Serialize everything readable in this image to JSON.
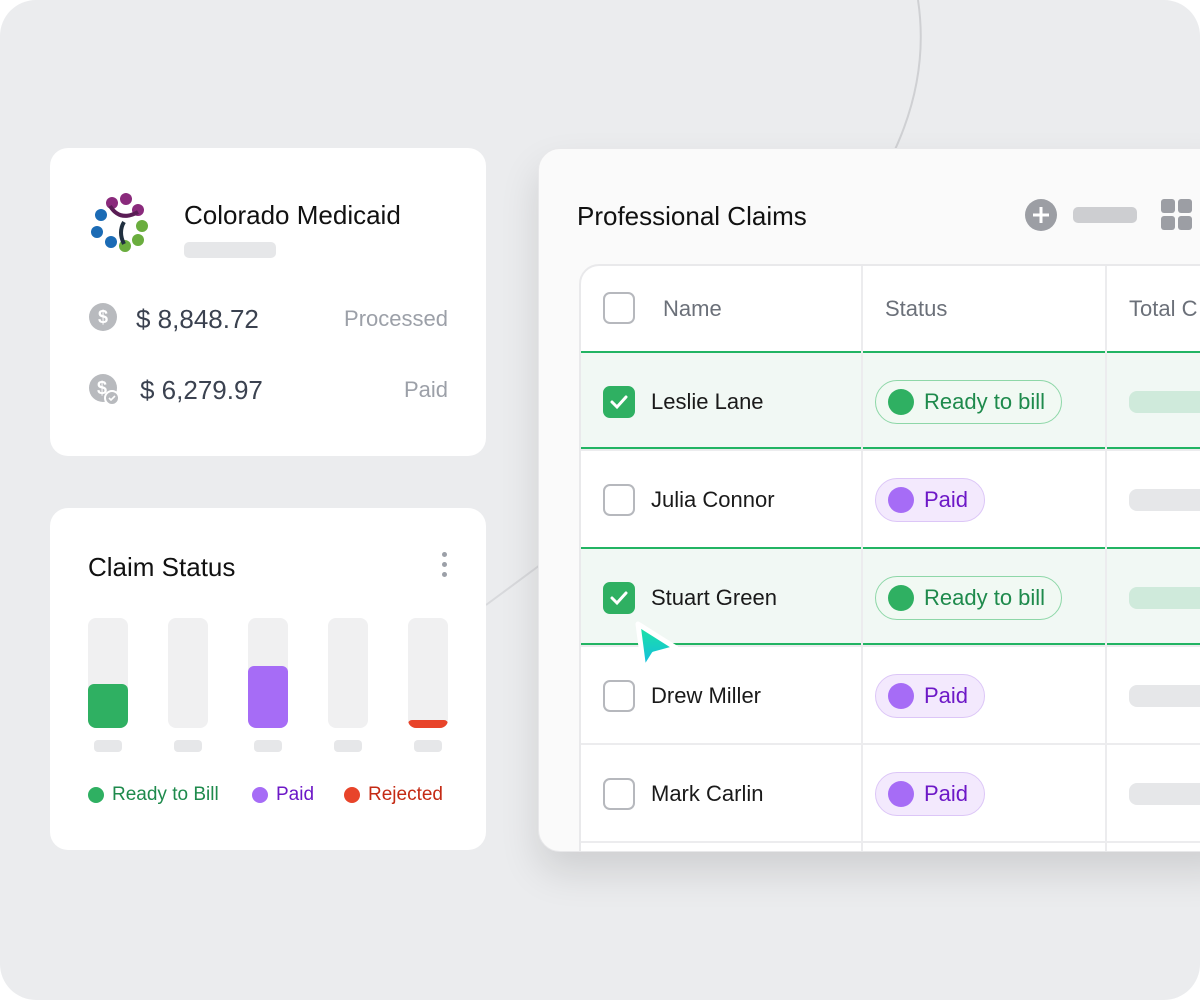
{
  "payer_card": {
    "name": "Colorado Medicaid",
    "processed_amount": "$ 8,848.72",
    "processed_label": "Processed",
    "paid_amount": "$ 6,279.97",
    "paid_label": "Paid",
    "icons": [
      "dollar-circle-icon",
      "dollar-check-icon"
    ]
  },
  "claim_status": {
    "title": "Claim Status",
    "menu_icon": "more-vertical-icon",
    "bars": [
      {
        "level": 0.4,
        "color": "#2fb062"
      },
      {
        "level": 0,
        "color": "#2fb062"
      },
      {
        "level": 0.56,
        "color": "#a66cf6"
      },
      {
        "level": 0,
        "color": "#a66cf6"
      },
      {
        "level": 0.07,
        "color": "#e8442a"
      }
    ],
    "legend": [
      {
        "label": "Ready to Bill",
        "color": "#2fb062",
        "text_color": "#1e8a4c"
      },
      {
        "label": "Paid",
        "color": "#a66cf6",
        "text_color": "#6d18c7"
      },
      {
        "label": "Rejected",
        "color": "#e8442a",
        "text_color": "#c42a14"
      }
    ]
  },
  "claims": {
    "title": "Professional Claims",
    "toolbar_icons": [
      "add-circle-icon",
      "grid-view-icon"
    ],
    "columns": [
      "Name",
      "Status",
      "Total C"
    ],
    "rows": [
      {
        "name": "Leslie Lane",
        "status": "Ready to bill",
        "selected": true
      },
      {
        "name": "Julia Connor",
        "status": "Paid",
        "selected": false
      },
      {
        "name": "Stuart Green",
        "status": "Ready to bill",
        "selected": true
      },
      {
        "name": "Drew Miller",
        "status": "Paid",
        "selected": false
      },
      {
        "name": "Mark Carlin",
        "status": "Paid",
        "selected": false
      }
    ]
  },
  "cursor_icon": "pointer-arrow-icon"
}
